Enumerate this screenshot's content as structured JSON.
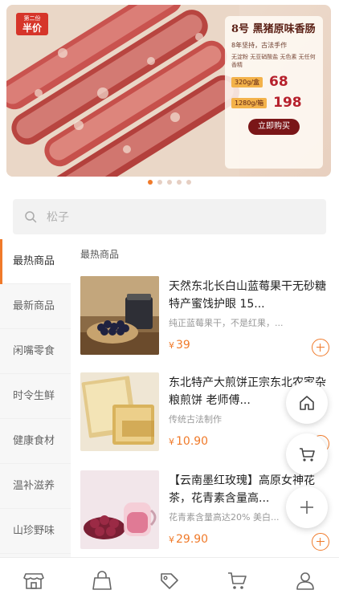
{
  "banner": {
    "badge_line1": "第二份",
    "badge_line2": "半价",
    "title": "8号 黑猪原味香肠",
    "subtitle": "8年坚持，古法手作",
    "features": "无淀粉 无亚硝酸盐 无色素 无任何香精",
    "price_rows": [
      {
        "tag": "320g/盒",
        "price": "68"
      },
      {
        "tag": "1280g/箱",
        "price": "198"
      }
    ],
    "buy_label": "立即购买",
    "dots_total": 5,
    "active_dot": 0
  },
  "search": {
    "placeholder": "松子",
    "icon": "search-icon"
  },
  "sidebar": {
    "items": [
      "最热商品",
      "最新商品",
      "闲嘴零食",
      "时令生鲜",
      "健康食材",
      "温补滋养",
      "山珍野味"
    ],
    "active_index": 0
  },
  "content": {
    "section_title": "最热商品",
    "products": [
      {
        "title": "天然东北长白山蓝莓果干无砂糖 特产蜜饯护眼 15...",
        "desc": "纯正蓝莓果干，不是红果，...",
        "currency": "¥",
        "price": "39"
      },
      {
        "title": "东北特产大煎饼正宗东北农家杂粮煎饼 老师傅...",
        "desc": "传统古法制作",
        "currency": "¥",
        "price": "10.90"
      },
      {
        "title": "【云南墨红玫瑰】高原女神花茶，花青素含量高...",
        "desc": "花青素含量高达20% 美白...",
        "currency": "¥",
        "price": "29.90"
      }
    ]
  },
  "floating": [
    "home-icon",
    "cart-icon",
    "plus-icon"
  ],
  "tabbar": [
    "store-icon",
    "bag-icon",
    "tag-icon",
    "cart-icon",
    "user-icon"
  ],
  "colors": {
    "accent": "#f07a2a",
    "banner_red": "#b6202c"
  }
}
